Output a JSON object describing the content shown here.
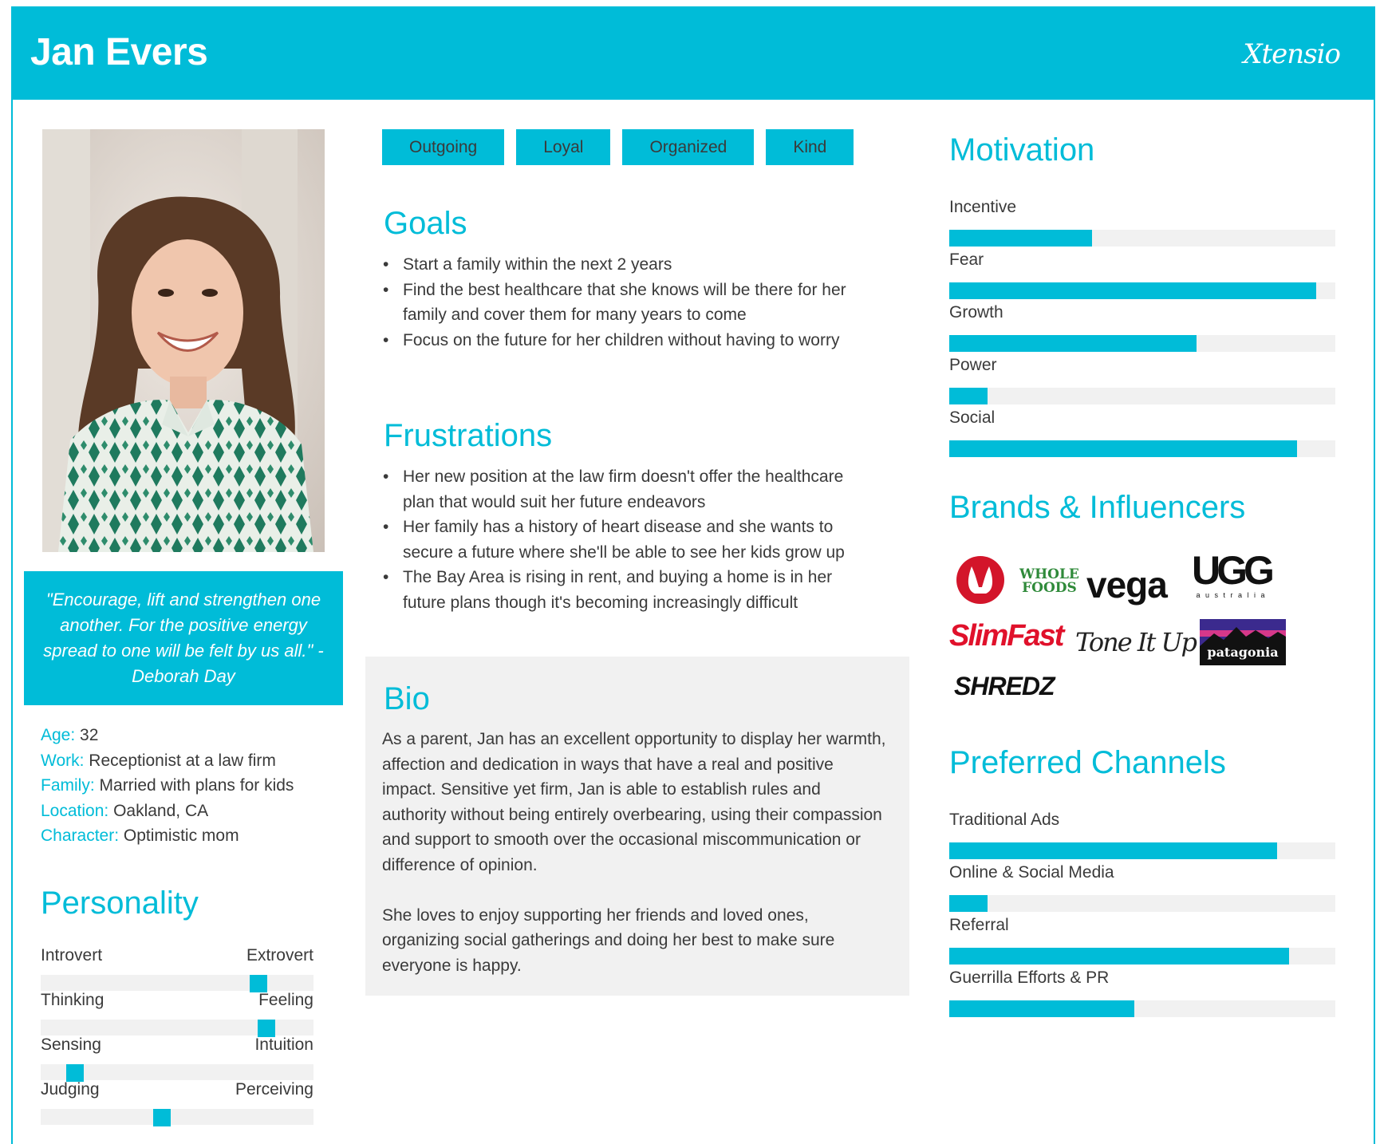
{
  "header": {
    "name": "Jan Evers",
    "logo": "Xtensio"
  },
  "quote": "\"Encourage, lift and strengthen one another. For the positive energy spread to one will be felt by us all.\" - Deborah Day",
  "facts": [
    {
      "key": "Age:",
      "value": "32"
    },
    {
      "key": "Work:",
      "value": "Receptionist at a law firm"
    },
    {
      "key": "Family:",
      "value": "Married with plans for kids"
    },
    {
      "key": "Location:",
      "value": "Oakland, CA"
    },
    {
      "key": "Character:",
      "value": "Optimistic mom"
    }
  ],
  "personality": {
    "title": "Personality",
    "traits": [
      {
        "left": "Introvert",
        "right": "Extrovert",
        "level": 0.82
      },
      {
        "left": "Thinking",
        "right": "Feeling",
        "level": 0.85
      },
      {
        "left": "Sensing",
        "right": "Intuition",
        "level": 0.1
      },
      {
        "left": "Judging",
        "right": "Perceiving",
        "level": 0.44
      }
    ]
  },
  "tags": [
    "Outgoing",
    "Loyal",
    "Organized",
    "Kind"
  ],
  "goals": {
    "title": "Goals",
    "items": [
      "Start a family within the next 2 years",
      "Find the best healthcare that she knows will be there for her family and cover them for many years to come",
      "Focus on the future for her children without having to worry"
    ]
  },
  "frustrations": {
    "title": "Frustrations",
    "items": [
      "Her new position at the law firm doesn't offer the healthcare plan that would suit her future endeavors",
      "Her family has a history of heart disease and she wants to secure a future where she'll be able to see her kids grow up",
      "The Bay Area is rising in rent, and buying a home is in her future plans though it's becoming increasingly difficult"
    ]
  },
  "bio": {
    "title": "Bio",
    "paragraphs": [
      "As a parent, Jan has an excellent opportunity to display her warmth, affection and dedication in ways that have a real and positive impact. Sensitive yet firm, Jan is able to establish rules and authority without being entirely overbearing, using their compassion and support to smooth over the occasional miscommunication or difference of opinion.",
      "She loves to enjoy supporting her friends and loved ones, organizing social gatherings and doing her best to make sure everyone is happy."
    ]
  },
  "motivation": {
    "title": "Motivation",
    "items": [
      {
        "label": "Incentive",
        "level": 0.37
      },
      {
        "label": "Fear",
        "level": 0.95
      },
      {
        "label": "Growth",
        "level": 0.64
      },
      {
        "label": "Power",
        "level": 0.1
      },
      {
        "label": "Social",
        "level": 0.9
      }
    ]
  },
  "brands": {
    "title": "Brands & Influencers",
    "logos": {
      "whole_foods_1": "WHOLE",
      "whole_foods_2": "FOODS",
      "vega": "vega",
      "ugg": "UGG",
      "ugg_sub": "a u s t r a l i a",
      "slimfast": "SlimFast",
      "toneitup": "Tone It Up",
      "patagonia": "patagonia",
      "shredz": "SHREDZ"
    }
  },
  "channels": {
    "title": "Preferred Channels",
    "items": [
      {
        "label": "Traditional Ads",
        "level": 0.85
      },
      {
        "label": "Online & Social Media",
        "level": 0.1
      },
      {
        "label": "Referral",
        "level": 0.88
      },
      {
        "label": "Guerrilla Efforts & PR",
        "level": 0.48
      }
    ]
  },
  "colors": {
    "accent": "#00bcd8",
    "track": "#f1f1f1",
    "text": "#3a3a3a"
  }
}
